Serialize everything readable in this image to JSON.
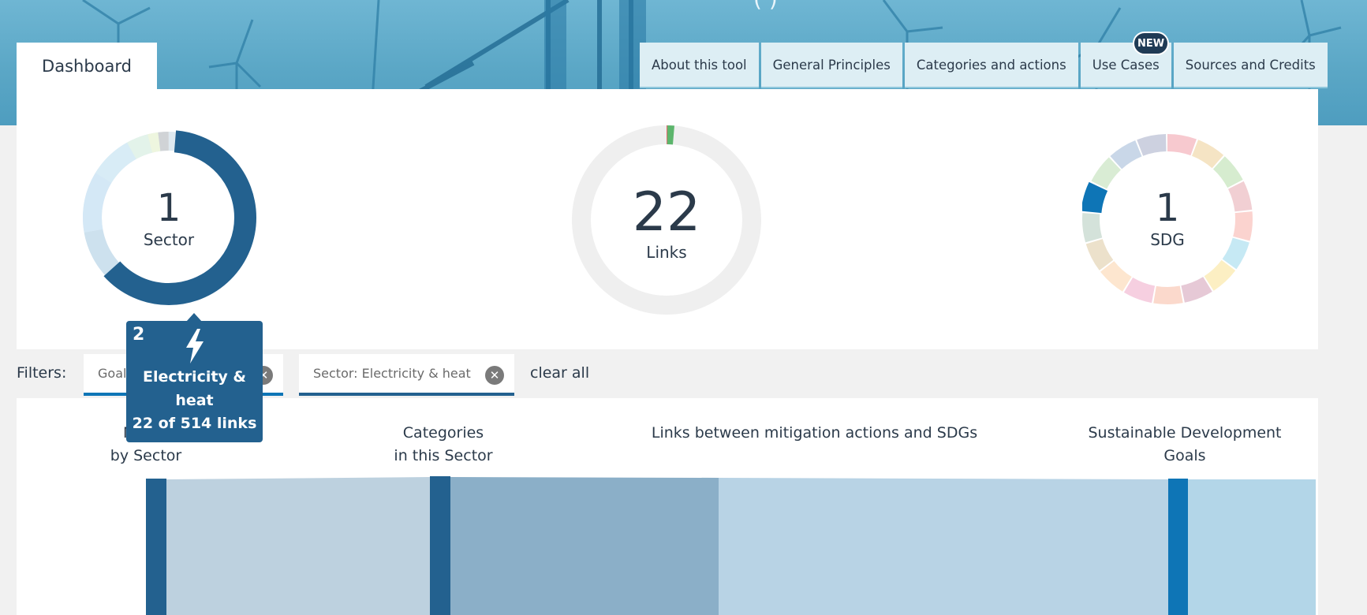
{
  "header": {
    "title_fragment": "(                    )"
  },
  "tabs": {
    "active": "Dashboard",
    "items": [
      {
        "label": "About this tool"
      },
      {
        "label": "General Principles"
      },
      {
        "label": "Categories and actions"
      },
      {
        "label": "Use Cases",
        "badge": "NEW"
      },
      {
        "label": "Sources and Credits"
      }
    ]
  },
  "summary": {
    "sector": {
      "count": "1",
      "label": "Sector",
      "selected_share": 0.62
    },
    "links": {
      "count": "22",
      "label": "Links"
    },
    "sdg": {
      "count": "1",
      "label": "SDG"
    }
  },
  "tooltip": {
    "index": "2",
    "name": "Electricity & heat",
    "count": "22",
    "links_suffix": "of 514 links",
    "icon": "lightning-bolt-icon"
  },
  "filters": {
    "label": "Filters:",
    "chips": [
      {
        "label": "Goal"
      },
      {
        "label": "Sector: Electricity & heat"
      }
    ],
    "clear_all": "clear all"
  },
  "sankey": {
    "col_mitigation": "Mitigation actions\nby Sector",
    "col_mitigation_visible": [
      "Mitiga",
      "by Sector"
    ],
    "col_categories": [
      "Categories",
      "in this Sector"
    ],
    "col_links": "Links between mitigation actions and SDGs",
    "col_sdg": [
      "Sustainable Development",
      "Goals"
    ]
  },
  "colors": {
    "primary": "#23618f",
    "sdg_selected": "#0e75b6",
    "hero": "#5ba7c6"
  }
}
